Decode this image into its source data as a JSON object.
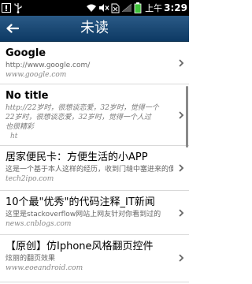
{
  "status_bar": {
    "ampm": "上午",
    "time": "3:29",
    "icons": [
      "alert-icon",
      "usb-icon",
      "wifi-icon",
      "mute-icon",
      "no-sim-icon",
      "signal-icon",
      "battery-icon"
    ]
  },
  "header": {
    "back_icon": "back-arrow-icon",
    "title": "未读"
  },
  "items": [
    {
      "title": "Google",
      "desc_lines": [
        "http://www.google.com/"
      ],
      "url": "www.google.com"
    },
    {
      "title": "No title",
      "desc_lines": [
        "http://22岁时，很想谈恋爱，32岁时，觉得一个",
        "22岁时，很想谈恋爱，32岁时，觉得一个人过",
        "也很精彩"
      ],
      "url": "ht"
    },
    {
      "title": "居家便民卡：方便生活的小APP ",
      "desc_lines": [
        "这是一个基于本人这样的经历，收到门缝中塞进来的便民"
      ],
      "url": "tech2ipo.com"
    },
    {
      "title": "10个最\"优秀\"的代码注释_IT新闻",
      "desc_lines": [
        "这里是stackoverflow网站上网友针对你看到过的"
      ],
      "url": "news.cnblogs.com"
    },
    {
      "title": "【原创】仿Iphone风格翻页控件",
      "desc_lines": [
        "炫丽的翻页效果"
      ],
      "url": "www.eoeandroid.com"
    }
  ]
}
